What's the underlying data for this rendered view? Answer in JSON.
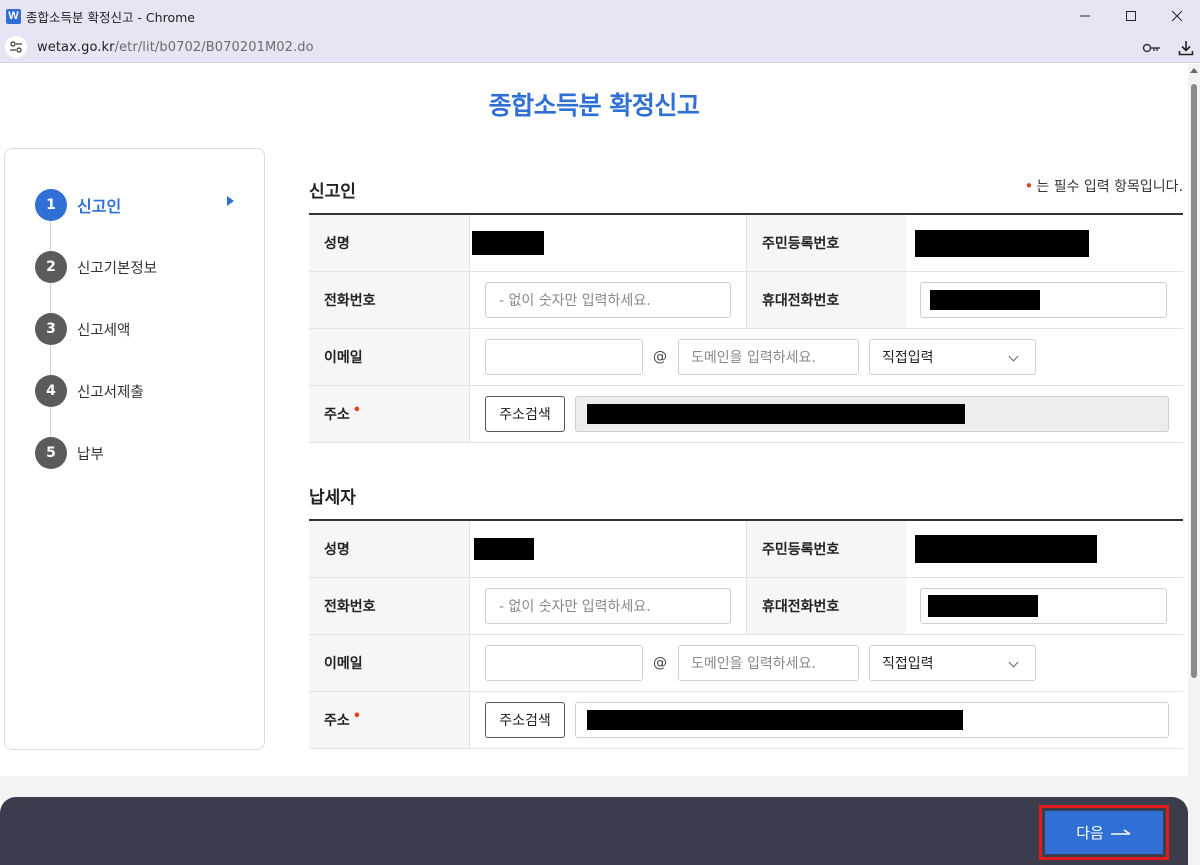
{
  "window": {
    "title": "종합소득분 확정신고 - Chrome",
    "app_icon_letter": "W"
  },
  "address_bar": {
    "host": "wetax.go.kr",
    "path": "/etr/lit/b0702/B070201M02.do"
  },
  "page_title": "종합소득분 확정신고",
  "steps": [
    {
      "num": "1",
      "label": "신고인",
      "active": true
    },
    {
      "num": "2",
      "label": "신고기본정보",
      "active": false
    },
    {
      "num": "3",
      "label": "신고세액",
      "active": false
    },
    {
      "num": "4",
      "label": "신고서제출",
      "active": false
    },
    {
      "num": "5",
      "label": "납부",
      "active": false
    }
  ],
  "required_note": "는 필수 입력 항목입니다.",
  "reporter": {
    "section_title": "신고인",
    "name_label": "성명",
    "rrn_label": "주민등록번호",
    "phone_label": "전화번호",
    "phone_placeholder": "- 없이 숫자만 입력하세요.",
    "mobile_label": "휴대전화번호",
    "email_label": "이메일",
    "email_at": "@",
    "domain_placeholder": "도메인을 입력하세요.",
    "domain_select": "직접입력",
    "address_label": "주소",
    "address_button": "주소검색"
  },
  "taxpayer": {
    "section_title": "납세자",
    "name_label": "성명",
    "rrn_label": "주민등록번호",
    "phone_label": "전화번호",
    "phone_placeholder": "- 없이 숫자만 입력하세요.",
    "mobile_label": "휴대전화번호",
    "email_label": "이메일",
    "email_at": "@",
    "domain_placeholder": "도메인을 입력하세요.",
    "domain_select": "직접입력",
    "address_label": "주소",
    "address_button": "주소검색"
  },
  "next_button": "다음",
  "colors": {
    "accent": "#2f6fd6",
    "required": "#e2431e",
    "bottom_bar": "#3c3d4c",
    "highlight_border": "#e01b1b"
  }
}
